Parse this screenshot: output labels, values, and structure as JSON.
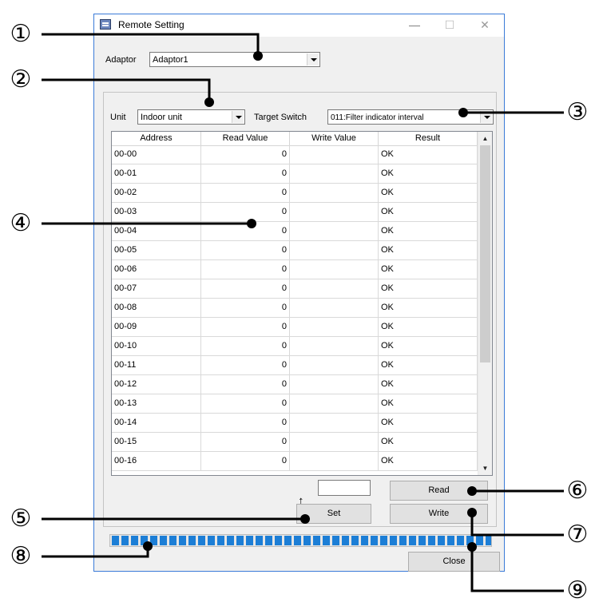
{
  "window": {
    "title": "Remote Setting",
    "minimize_glyph": "—",
    "maximize_glyph": "☐",
    "close_glyph": "✕"
  },
  "adaptor": {
    "label": "Adaptor",
    "value": "Adaptor1"
  },
  "unit": {
    "label": "Unit",
    "value": "Indoor unit"
  },
  "target_switch": {
    "label": "Target Switch",
    "value": "011:Filter indicator interval"
  },
  "grid": {
    "columns": [
      "Address",
      "Read Value",
      "Write Value",
      "Result"
    ],
    "rows": [
      {
        "address": "00-00",
        "read": "0",
        "write": "",
        "result": "OK"
      },
      {
        "address": "00-01",
        "read": "0",
        "write": "",
        "result": "OK"
      },
      {
        "address": "00-02",
        "read": "0",
        "write": "",
        "result": "OK"
      },
      {
        "address": "00-03",
        "read": "0",
        "write": "",
        "result": "OK"
      },
      {
        "address": "00-04",
        "read": "0",
        "write": "",
        "result": "OK"
      },
      {
        "address": "00-05",
        "read": "0",
        "write": "",
        "result": "OK"
      },
      {
        "address": "00-06",
        "read": "0",
        "write": "",
        "result": "OK"
      },
      {
        "address": "00-07",
        "read": "0",
        "write": "",
        "result": "OK"
      },
      {
        "address": "00-08",
        "read": "0",
        "write": "",
        "result": "OK"
      },
      {
        "address": "00-09",
        "read": "0",
        "write": "",
        "result": "OK"
      },
      {
        "address": "00-10",
        "read": "0",
        "write": "",
        "result": "OK"
      },
      {
        "address": "00-11",
        "read": "0",
        "write": "",
        "result": "OK"
      },
      {
        "address": "00-12",
        "read": "0",
        "write": "",
        "result": "OK"
      },
      {
        "address": "00-13",
        "read": "0",
        "write": "",
        "result": "OK"
      },
      {
        "address": "00-14",
        "read": "0",
        "write": "",
        "result": "OK"
      },
      {
        "address": "00-15",
        "read": "0",
        "write": "",
        "result": "OK"
      },
      {
        "address": "00-16",
        "read": "0",
        "write": "",
        "result": "OK"
      }
    ]
  },
  "buttons": {
    "read": "Read",
    "write": "Write",
    "set": "Set",
    "close": "Close"
  },
  "set_value": {
    "arrow_glyph": "↑",
    "value": ""
  },
  "progress": {
    "fraction": 1.0,
    "color": "#1c7ed6"
  },
  "callouts": [
    "①",
    "②",
    "③",
    "④",
    "⑤",
    "⑥",
    "⑦",
    "⑧",
    "⑨"
  ],
  "icons": {
    "scroll_up": "▲",
    "scroll_down": "▼"
  }
}
